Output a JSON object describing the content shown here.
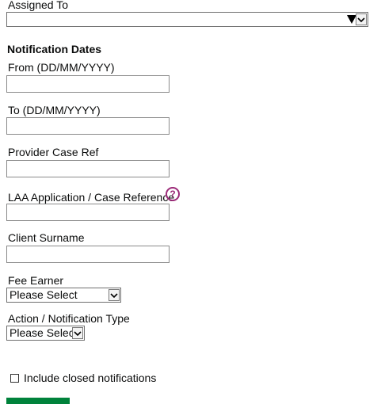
{
  "assigned_to": {
    "label": "Assigned To",
    "value": ""
  },
  "notification_dates": {
    "heading": "Notification Dates",
    "from": {
      "label": "From (DD/MM/YYYY)",
      "value": ""
    },
    "to": {
      "label": "To (DD/MM/YYYY)",
      "value": ""
    }
  },
  "provider_case_ref": {
    "label": "Provider Case Ref",
    "value": ""
  },
  "laa_reference": {
    "label": "LAA Application / Case Reference",
    "value": "",
    "help_icon": "question-mark"
  },
  "client_surname": {
    "label": "Client Surname",
    "value": ""
  },
  "fee_earner": {
    "label": "Fee Earner",
    "selected": "Please Select"
  },
  "action_type": {
    "label": "Action / Notification Type",
    "selected": "Please Select"
  },
  "include_closed": {
    "label": "Include closed notifications",
    "checked": false
  },
  "colors": {
    "submit_button": "#00823b",
    "help_icon": "#9c2b79"
  }
}
